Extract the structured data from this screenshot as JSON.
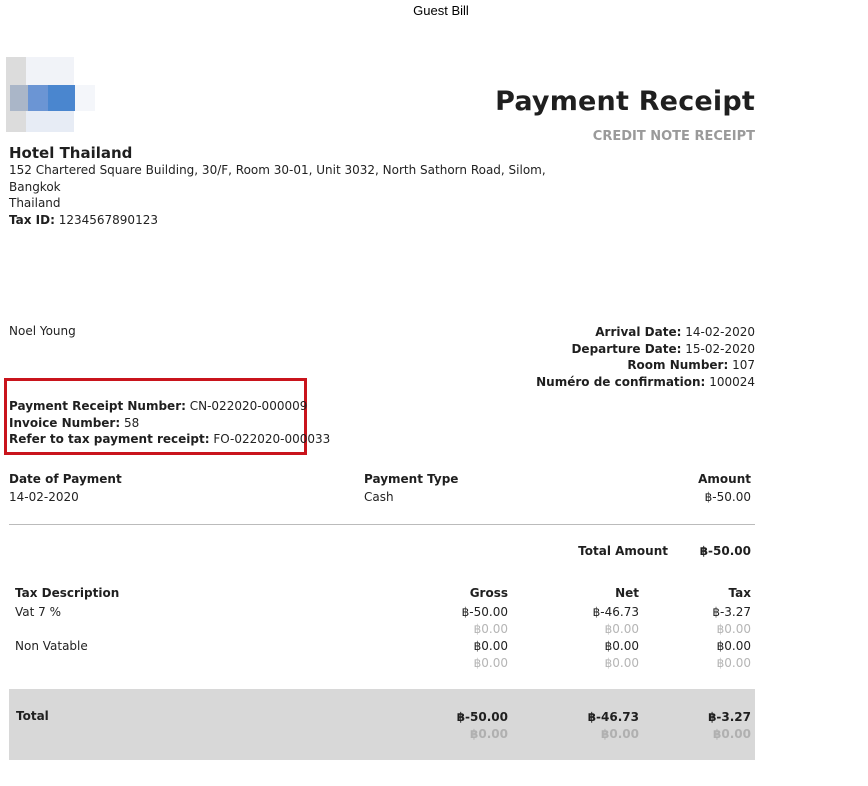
{
  "header": {
    "title": "Guest Bill"
  },
  "logo": {
    "name": "hotel-logo"
  },
  "document": {
    "title": "Payment Receipt",
    "subtitle": "CREDIT NOTE RECEIPT"
  },
  "company": {
    "name": "Hotel Thailand",
    "address_line1": "152 Chartered Square Building, 30/F, Room 30-01, Unit 3032, North Sathorn Road, Silom,",
    "address_line2": "Bangkok",
    "address_line3": "Thailand",
    "tax_id_label": "Tax ID:",
    "tax_id": "1234567890123"
  },
  "guest": {
    "name": "Noel Young"
  },
  "stay": {
    "arrival_label": "Arrival Date:",
    "arrival": "14-02-2020",
    "departure_label": "Departure Date:",
    "departure": "15-02-2020",
    "room_label": "Room Number:",
    "room": "107",
    "confirmation_label": "Numéro de confirmation:",
    "confirmation": "100024"
  },
  "refs": {
    "receipt_label": "Payment Receipt Number:",
    "receipt": "CN-022020-000009",
    "invoice_label": "Invoice Number:",
    "invoice": "58",
    "tax_ref_label": "Refer to tax payment receipt:",
    "tax_ref": "FO-022020-000033"
  },
  "payment": {
    "headers": {
      "date": "Date of Payment",
      "type": "Payment Type",
      "amount": "Amount"
    },
    "row": {
      "date": "14-02-2020",
      "type": "Cash",
      "amount": "฿-50.00"
    },
    "total_label": "Total Amount",
    "total": "฿-50.00"
  },
  "tax": {
    "headers": {
      "description": "Tax Description",
      "gross": "Gross",
      "net": "Net",
      "tax": "Tax"
    },
    "rows": [
      {
        "description": "Vat 7 %",
        "gross": "฿-50.00",
        "gross_sub": "฿0.00",
        "net": "฿-46.73",
        "net_sub": "฿0.00",
        "tax": "฿-3.27",
        "tax_sub": "฿0.00"
      },
      {
        "description": "Non Vatable",
        "gross": "฿0.00",
        "gross_sub": "฿0.00",
        "net": "฿0.00",
        "net_sub": "฿0.00",
        "tax": "฿0.00",
        "tax_sub": "฿0.00"
      }
    ],
    "total": {
      "label": "Total",
      "gross": "฿-50.00",
      "gross_sub": "฿0.00",
      "net": "฿-46.73",
      "net_sub": "฿0.00",
      "tax": "฿-3.27",
      "tax_sub": "฿0.00"
    }
  },
  "colors": {
    "highlight_border": "#c9141c",
    "total_bar": "#d8d8d8",
    "muted": "#b5b5b5"
  }
}
